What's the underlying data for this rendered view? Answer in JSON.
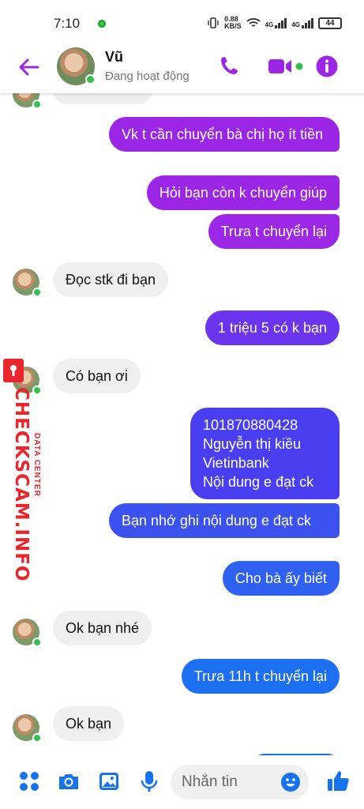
{
  "status_bar": {
    "time": "7:10",
    "speed_value": "0.88",
    "speed_unit": "KB/S",
    "network_1": "4G",
    "network_2": "4G",
    "battery": "44"
  },
  "header": {
    "contact_name": "Vũ",
    "contact_status": "Đang hoạt động"
  },
  "messages": [
    {
      "side": "out",
      "text": "Vk t cần chuyển bà chị họ ít tiền"
    },
    {
      "side": "out",
      "text": "Hỏi bạn còn k chuyển giúp"
    },
    {
      "side": "out",
      "text": "Trưa t chuyển lại"
    },
    {
      "side": "in",
      "text": "Đọc stk đi bạn"
    },
    {
      "side": "out",
      "text": "1 triệu 5 có k bạn"
    },
    {
      "side": "in",
      "text": "Có bạn ơi"
    },
    {
      "side": "out",
      "text": "101870880428\nNguyễn thị kiều\nVietinbank\nNội dung e đạt ck"
    },
    {
      "side": "out",
      "text": "Bạn nhớ ghi nội dung e đạt ck"
    },
    {
      "side": "out",
      "text": "Cho bà ấy biết"
    },
    {
      "side": "in",
      "text": "Ok bạn nhé"
    },
    {
      "side": "out",
      "text": "Trưa 11h t chuyển lại"
    },
    {
      "side": "in",
      "text": "Ok bạn"
    }
  ],
  "watermark": {
    "site": "CHECKSCAM.INFO",
    "tagline": "DATA CENTER"
  },
  "composer": {
    "placeholder": "Nhắn tin"
  },
  "icons": {
    "back": "arrow-left-icon",
    "call": "phone-icon",
    "video": "video-camera-icon",
    "info": "info-icon",
    "menu": "four-dots-icon",
    "camera": "camera-icon",
    "gallery": "image-icon",
    "mic": "microphone-icon",
    "emoji": "smiley-icon",
    "like": "thumbs-up-icon"
  },
  "colors": {
    "accent_purple": "#9b26e6",
    "accent_blue": "#1673f0",
    "incoming_bubble": "#efefef",
    "online": "#31c24d"
  }
}
